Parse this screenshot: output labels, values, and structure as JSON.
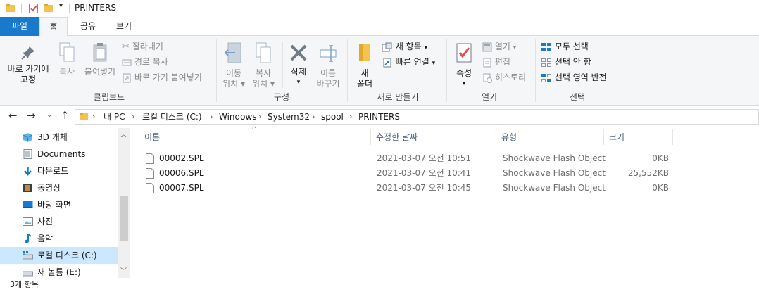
{
  "title": "PRINTERS",
  "ribbon_tabs": [
    "파일",
    "홈",
    "공유",
    "보기"
  ],
  "clipboard": {
    "pin_label_1": "바로 가기에",
    "pin_label_2": "고정",
    "copy": "복사",
    "paste": "붙여넣기",
    "cut": "잘라내기",
    "copy_path": "경로 복사",
    "paste_shortcut": "바로 가기 붙여넣기",
    "group": "클립보드"
  },
  "organize": {
    "move_1": "이동",
    "move_2": "위치",
    "copy_1": "복사",
    "copy_2": "위치",
    "delete": "삭제",
    "rename_1": "이름",
    "rename_2": "바꾸기",
    "group": "구성"
  },
  "new": {
    "folder_1": "새",
    "folder_2": "폴더",
    "new_item": "새 항목",
    "easy_access": "빠른 연결",
    "group": "새로 만들기"
  },
  "open": {
    "properties": "속성",
    "open": "열기",
    "edit": "편집",
    "history": "히스토리",
    "group": "열기"
  },
  "select": {
    "all": "모두 선택",
    "none": "선택 안 함",
    "invert": "선택 영역 반전",
    "group": "선택"
  },
  "address": {
    "crumbs": [
      "내 PC",
      "로컬 디스크 (C:)",
      "Windows",
      "System32",
      "spool",
      "PRINTERS"
    ]
  },
  "nav": {
    "items": [
      "3D 개체",
      "Documents",
      "다운로드",
      "동영상",
      "바탕 화면",
      "사진",
      "음악",
      "로컬 디스크 (C:)",
      "새 볼륨 (E:)"
    ]
  },
  "columns": [
    "이름",
    "수정한 날짜",
    "유형",
    "크기"
  ],
  "files": [
    {
      "name": "00002.SPL",
      "date": "2021-03-07 오전 10:51",
      "type": "Shockwave Flash Object",
      "size": "0KB"
    },
    {
      "name": "00006.SPL",
      "date": "2021-03-07 오전 10:41",
      "type": "Shockwave Flash Object",
      "size": "25,552KB"
    },
    {
      "name": "00007.SPL",
      "date": "2021-03-07 오전 10:45",
      "type": "Shockwave Flash Object",
      "size": "0KB"
    }
  ],
  "status": "3개 항목",
  "colors": {
    "accent": "#1979ca",
    "selection": "#cce8ff",
    "folder": "#f4c24f"
  }
}
